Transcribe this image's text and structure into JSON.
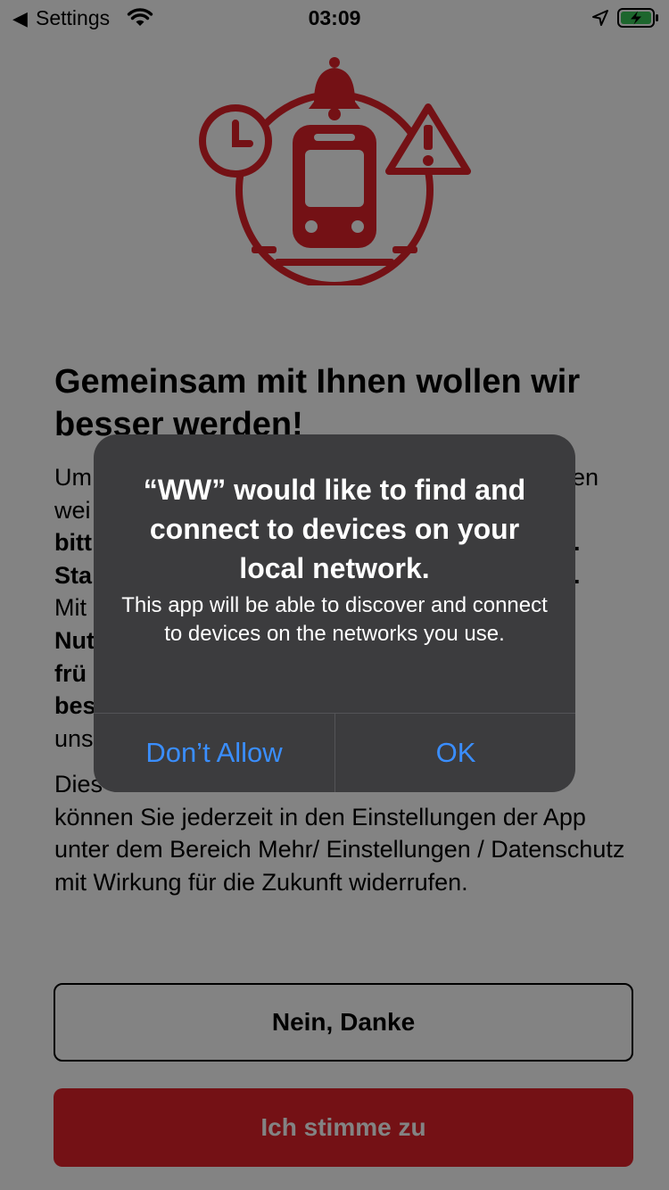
{
  "status_bar": {
    "back_app": "Settings",
    "time": "03:09",
    "icons": [
      "back-arrow-icon",
      "wifi-icon",
      "location-arrow-icon",
      "battery-charging-icon"
    ]
  },
  "hero": {
    "icon": "train-alert-illustration",
    "color": "#e2222a"
  },
  "headline": "Gemeinsam mit Ihnen wollen wir besser werden!",
  "body": {
    "line1": "Um",
    "line1_end": "en",
    "line2": "wei",
    "line3_bold": "bitt",
    "line3_end": ".",
    "line4_bold": "Sta",
    "line4_end": ".",
    "line5": "Mit",
    "line6_bold": "Nut",
    "line7_bold": "frü",
    "line8_bold": "bes",
    "line9": "uns",
    "bottom_line1_start": "Dies",
    "bottom_line1_end": "",
    "bottom_rest": "können Sie jederzeit in den Einstellungen der App unter dem Bereich Mehr/ Einstellungen / Datenschutz mit Wirkung für die Zukunft widerrufen."
  },
  "buttons": {
    "decline": "Nein, Danke",
    "accept": "Ich stimme zu",
    "accept_color": "#e2222a"
  },
  "alert": {
    "title": "“WW” would like to find and connect to devices on your local network.",
    "message": "This app will be able to discover and connect to devices on the networks you use.",
    "dont_allow": "Don’t Allow",
    "ok": "OK",
    "button_color": "#3a8eff"
  }
}
